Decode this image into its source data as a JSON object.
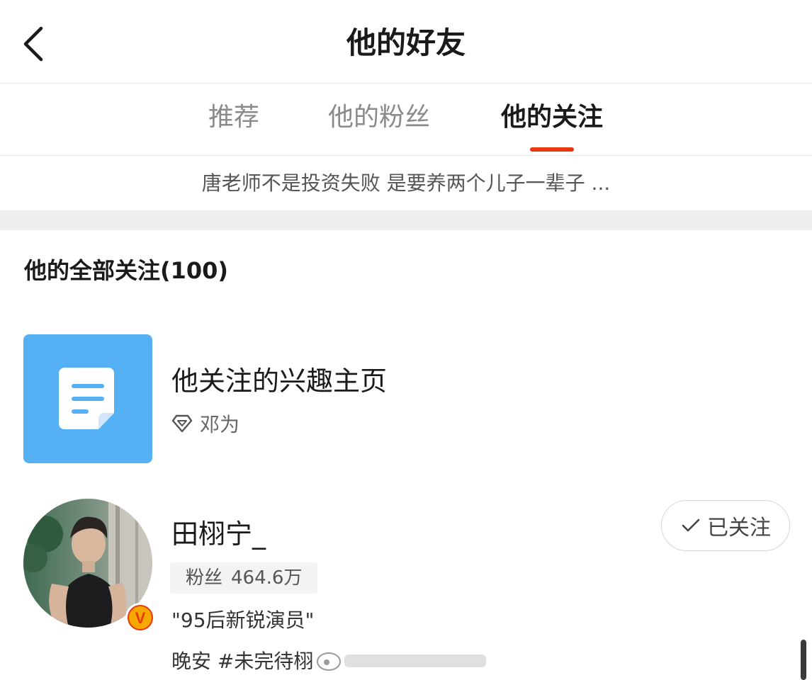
{
  "header": {
    "title": "他的好友",
    "back_icon": "chevron-left-icon"
  },
  "tabs": [
    {
      "label": "推荐",
      "active": false
    },
    {
      "label": "他的粉丝",
      "active": false
    },
    {
      "label": "他的关注",
      "active": true
    }
  ],
  "colors": {
    "accent": "#e8380d",
    "tile": "#55b1f3",
    "badge": "#f6a700"
  },
  "notice": "唐老师不是投资失败 是要养两个儿子一辈子 ...",
  "section": {
    "title": "他的全部关注(100)"
  },
  "interest_item": {
    "icon": "document-icon",
    "title": "他关注的兴趣主页",
    "sub_icon": "diamond-icon",
    "sub_text": "邓为"
  },
  "users": [
    {
      "name": "田栩宁_",
      "fans_label": "粉丝",
      "fans_count": "464.6万",
      "verified_badge": "V",
      "description": "\"95后新锐演员\"",
      "post_text": "晚安 #未完待栩",
      "follow_button": {
        "icon": "check-icon",
        "label": "已关注"
      }
    }
  ]
}
